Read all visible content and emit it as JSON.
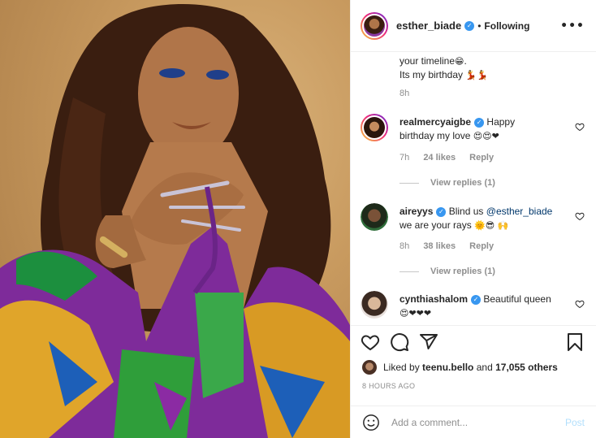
{
  "post": {
    "username": "esther_biade",
    "follow_status": "Following",
    "more_label": "•••",
    "caption_tail_line1": "your timeline",
    "caption_tail_emoji1": "😁",
    "caption_tail_line1_end": ".",
    "caption_tail_line2": "Its my birthday",
    "caption_tail_emoji2": "💃💃",
    "caption_time": "8h"
  },
  "comments": [
    {
      "username": "realmercyaigbe",
      "text_pre": "Happy",
      "text_line2": "birthday my love",
      "emojis": "😍😍❤",
      "time": "7h",
      "likes": "24 likes",
      "reply": "Reply",
      "view_replies": "View replies (1)"
    },
    {
      "username": "aireyys",
      "text_pre": "Blind us",
      "mention": "@esther_biade",
      "text_line2": "we are your rays",
      "emojis": "🌞😎 🙌",
      "time": "8h",
      "likes": "38 likes",
      "reply": "Reply",
      "view_replies": "View replies (1)"
    },
    {
      "username": "cynthiashalom",
      "text_pre": "Beautiful queen",
      "emojis": "😍❤❤❤"
    }
  ],
  "actions": {
    "liked_by_prefix": "Liked by",
    "liked_by_user": "teenu.bello",
    "liked_by_and": "and",
    "liked_by_others": "17,055 others",
    "timestamp": "8 HOURS AGO",
    "comment_placeholder": "Add a comment...",
    "post_label": "Post"
  },
  "colors": {
    "accent": "#3897f0",
    "post_disabled": "#b2dffc",
    "muted": "#8e8e8e"
  },
  "icons": [
    "verified-badge-icon",
    "more-icon",
    "heart-icon",
    "comment-icon",
    "share-icon",
    "bookmark-icon",
    "smile-icon"
  ]
}
